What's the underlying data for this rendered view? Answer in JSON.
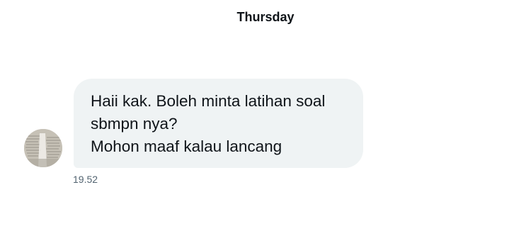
{
  "conversation": {
    "day_separator": "Thursday"
  },
  "message": {
    "lines": [
      "Haii kak. Boleh minta latihan soal",
      "sbmpn nya?",
      "Mohon maaf kalau lancang"
    ],
    "timestamp": "19.52",
    "bubble_color": "#eff3f4",
    "text_color": "#0f1419",
    "timestamp_color": "#536471"
  },
  "sender": {
    "avatar_icon": "user-avatar-photo"
  }
}
